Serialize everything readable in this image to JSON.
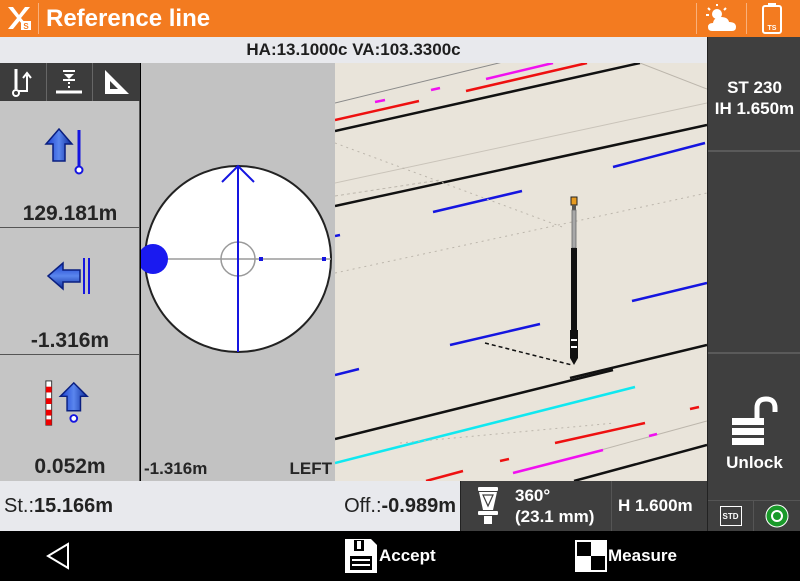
{
  "app": {
    "title": "Reference line",
    "logo_icon": "x-survey-logo-icon",
    "weather_icon": "partly-sunny-icon",
    "battery_icon": "battery-ts-icon",
    "battery_label": "TS"
  },
  "angles": {
    "text": "HA:13.1000c  VA:103.3300c"
  },
  "left_panel": {
    "tools": [
      {
        "name": "stakeout-direction-tool",
        "icon": "pole-arrow-icon"
      },
      {
        "name": "level-tool",
        "icon": "level-marker-icon"
      },
      {
        "name": "triangle-tool",
        "icon": "set-square-icon"
      }
    ],
    "values": [
      {
        "icon": "forward-arrow-icon",
        "value": "129.181m"
      },
      {
        "icon": "left-arrow-icon",
        "value": "-1.316m"
      },
      {
        "icon": "fill-up-arrow-icon",
        "value": "0.052m"
      }
    ]
  },
  "circle_view": {
    "offset": "-1.316m",
    "side": "LEFT"
  },
  "right_panel": {
    "station": "ST 230",
    "instrument_height": "IH 1.650m",
    "unlock_label": "Unlock",
    "std_label": "STD",
    "status_color": "#1a9a2a"
  },
  "info_bar": {
    "station_label": "St.:",
    "station_value": "15.166m",
    "offset_label": "Off.:",
    "offset_value": "-0.989m"
  },
  "prism": {
    "type": "360°",
    "constant": "(23.1 mm)",
    "height": "H 1.600m"
  },
  "nav": {
    "accept_label": "Accept",
    "measure_label": "Measure"
  },
  "colors": {
    "brand": "#f37b20",
    "panel_dark": "#3f3f3f",
    "accent_blue": "#1515e0"
  }
}
